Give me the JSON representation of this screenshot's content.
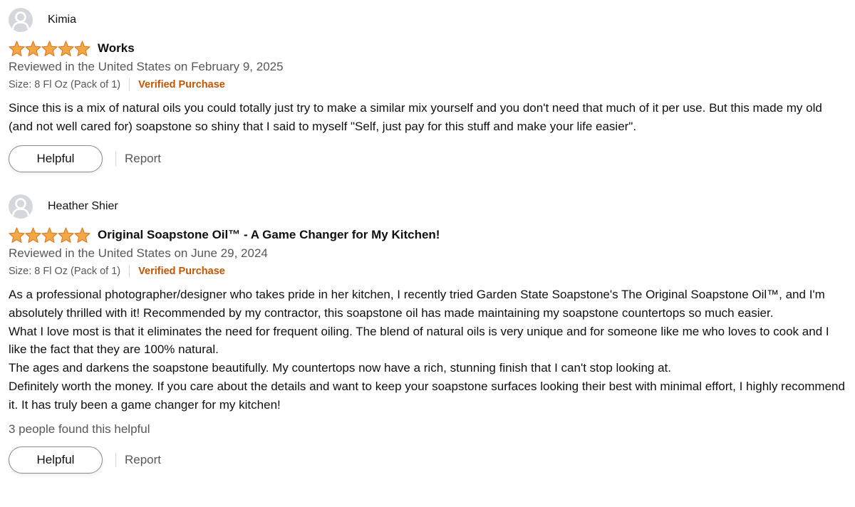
{
  "colors": {
    "star": "#f3a847",
    "verified": "#c45500",
    "secondary_text": "#565959"
  },
  "reviews": [
    {
      "reviewer": "Kimia",
      "rating": 5,
      "title": "Works",
      "date": "Reviewed in the United States on February 9, 2025",
      "size": "Size: 8 Fl Oz (Pack of 1)",
      "verified": "Verified Purchase",
      "body": [
        "Since this is a mix of natural oils you could totally just try to make a similar mix yourself and you don't need that much of it per use. But this made my old (and not well cared for) soapstone so shiny that I said to myself \"Self, just pay for this stuff and make your life easier\"."
      ],
      "helpful_count": "",
      "helpful_label": "Helpful",
      "report_label": "Report"
    },
    {
      "reviewer": "Heather Shier",
      "rating": 5,
      "title": "Original Soapstone Oil™ - A Game Changer for My Kitchen!",
      "date": "Reviewed in the United States on June 29, 2024",
      "size": "Size: 8 Fl Oz (Pack of 1)",
      "verified": "Verified Purchase",
      "body": [
        "As a professional photographer/designer who takes pride in her kitchen, I recently tried Garden State Soapstone's The Original Soapstone Oil™, and I'm absolutely thrilled with it! Recommended by my contractor, this soapstone oil has made maintaining my soapstone countertops so much easier.",
        "What I love most is that it eliminates the need for frequent oiling. The blend of natural oils is very unique and for someone like me who loves to cook and I like the fact that they are 100% natural.",
        "The ages and darkens the soapstone beautifully. My countertops now have a rich, stunning finish that I can't stop looking at.",
        "Definitely worth the money. If you care about the details and want to keep your soapstone surfaces looking their best with minimal effort, I highly recommend it. It has truly been a game changer for my kitchen!"
      ],
      "helpful_count": "3 people found this helpful",
      "helpful_label": "Helpful",
      "report_label": "Report"
    }
  ]
}
